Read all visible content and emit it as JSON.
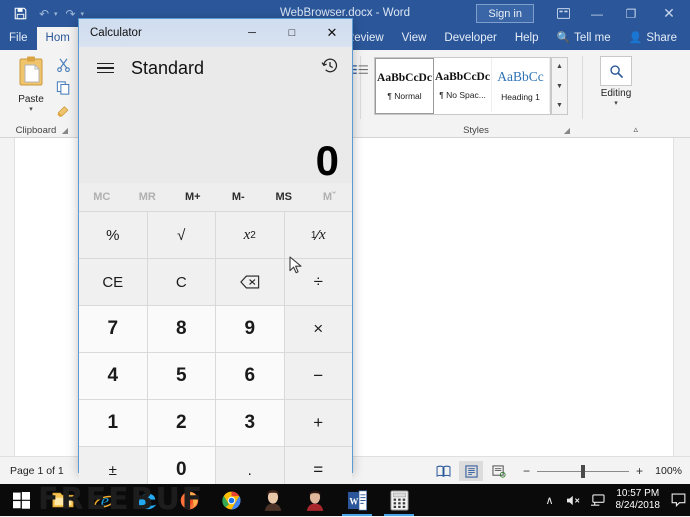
{
  "word": {
    "title": "WebBrowser.docx  -  Word",
    "quick_access": [
      {
        "name": "save-icon",
        "glyph": "💾"
      },
      {
        "name": "undo-icon",
        "glyph": "↶"
      },
      {
        "name": "redo-icon",
        "glyph": "↷"
      },
      {
        "name": "customize-qat-icon",
        "glyph": "⌄"
      }
    ],
    "signin_label": "Sign in",
    "titlebar_buttons": [
      {
        "name": "ribbon-display-options-icon",
        "glyph": "⌧"
      },
      {
        "name": "minimize-icon",
        "glyph": "—"
      },
      {
        "name": "restore-icon",
        "glyph": "❐"
      },
      {
        "name": "close-icon",
        "glyph": "✕"
      }
    ],
    "tabs_left": [
      {
        "label": "File",
        "active": false
      },
      {
        "label": "Hom",
        "active": true
      }
    ],
    "tabs_right": [
      {
        "label": "Review"
      },
      {
        "label": "View"
      },
      {
        "label": "Developer"
      },
      {
        "label": "Help"
      }
    ],
    "tell_me": "Tell me",
    "share": "Share",
    "groups": {
      "clipboard": {
        "label": "Clipboard",
        "paste_label": "Paste",
        "mini_icons": [
          "cut-icon",
          "copy-icon",
          "format-painter-icon"
        ]
      },
      "styles": {
        "label": "Styles",
        "items": [
          {
            "preview": "AaBbCcDc",
            "name": "¶ Normal",
            "selected": true,
            "kind": "body"
          },
          {
            "preview": "AaBbCcDc",
            "name": "¶ No Spac...",
            "selected": false,
            "kind": "body"
          },
          {
            "preview": "AaBbCс",
            "name": "Heading 1",
            "selected": false,
            "kind": "h1"
          }
        ]
      },
      "editing": {
        "label": "Editing",
        "icon": "search-icon",
        "caret": "⌄"
      }
    },
    "ribbon_collapse_icon": "chevron-up-icon",
    "status": {
      "page": "Page 1 of 1",
      "views": [
        {
          "name": "read-mode-view-button",
          "glyph": "📖",
          "active": false
        },
        {
          "name": "print-layout-view-button",
          "glyph": "☰",
          "active": true
        },
        {
          "name": "web-layout-view-button",
          "glyph": "🗏",
          "active": false
        }
      ],
      "zoom_minus": "−",
      "zoom_plus": "+",
      "zoom_value": "100%"
    }
  },
  "calculator": {
    "window_title": "Calculator",
    "window_buttons": [
      {
        "name": "calc-minimize-button",
        "glyph": "─"
      },
      {
        "name": "calc-maximize-button",
        "glyph": "□"
      },
      {
        "name": "calc-close-button",
        "glyph": "✕"
      }
    ],
    "menu_icon": "hamburger-menu-icon",
    "mode": "Standard",
    "history_icon": "history-icon",
    "display_value": "0",
    "memory_buttons": [
      {
        "label": "MC",
        "enabled": false
      },
      {
        "label": "MR",
        "enabled": false
      },
      {
        "label": "M+",
        "enabled": true
      },
      {
        "label": "M-",
        "enabled": true
      },
      {
        "label": "MS",
        "enabled": true
      },
      {
        "label": "Mˇ",
        "enabled": false
      }
    ],
    "keys": [
      {
        "label": "%",
        "type": "fn",
        "name": "percent-key"
      },
      {
        "label": "√",
        "type": "fn",
        "name": "square-root-key"
      },
      {
        "label": "x²",
        "type": "fn",
        "name": "square-key"
      },
      {
        "label": "¹⁄x",
        "type": "fn",
        "name": "reciprocal-key"
      },
      {
        "label": "CE",
        "type": "fn",
        "name": "clear-entry-key"
      },
      {
        "label": "C",
        "type": "fn",
        "name": "clear-key"
      },
      {
        "label": "⌫",
        "type": "fn",
        "name": "backspace-key"
      },
      {
        "label": "÷",
        "type": "op",
        "name": "divide-key"
      },
      {
        "label": "7",
        "type": "num",
        "name": "digit-7-key"
      },
      {
        "label": "8",
        "type": "num",
        "name": "digit-8-key"
      },
      {
        "label": "9",
        "type": "num",
        "name": "digit-9-key"
      },
      {
        "label": "×",
        "type": "op",
        "name": "multiply-key"
      },
      {
        "label": "4",
        "type": "num",
        "name": "digit-4-key"
      },
      {
        "label": "5",
        "type": "num",
        "name": "digit-5-key"
      },
      {
        "label": "6",
        "type": "num",
        "name": "digit-6-key"
      },
      {
        "label": "−",
        "type": "op",
        "name": "subtract-key"
      },
      {
        "label": "1",
        "type": "num",
        "name": "digit-1-key"
      },
      {
        "label": "2",
        "type": "num",
        "name": "digit-2-key"
      },
      {
        "label": "3",
        "type": "num",
        "name": "digit-3-key"
      },
      {
        "label": "+",
        "type": "op",
        "name": "add-key"
      },
      {
        "label": "±",
        "type": "fn",
        "name": "plus-minus-key"
      },
      {
        "label": "0",
        "type": "num",
        "name": "digit-0-key"
      },
      {
        "label": ".",
        "type": "fn",
        "name": "decimal-point-key"
      },
      {
        "label": "=",
        "type": "op",
        "name": "equals-key"
      }
    ]
  },
  "taskbar": {
    "items": [
      {
        "name": "start-button",
        "icon": "windows-logo-icon",
        "running": false
      },
      {
        "name": "taskbar-file-explorer",
        "icon": "folder-icon",
        "running": false
      },
      {
        "name": "taskbar-internet-explorer",
        "icon": "internet-explorer-icon",
        "running": false
      },
      {
        "name": "taskbar-edge",
        "icon": "edge-icon",
        "running": false
      },
      {
        "name": "taskbar-firefox",
        "icon": "firefox-icon",
        "running": false
      },
      {
        "name": "taskbar-chrome",
        "icon": "chrome-icon",
        "running": false
      },
      {
        "name": "taskbar-photos-1",
        "icon": "person-photo-icon",
        "running": false
      },
      {
        "name": "taskbar-photos-2",
        "icon": "person-photo-icon",
        "running": false
      },
      {
        "name": "taskbar-word",
        "icon": "word-icon",
        "running": true
      },
      {
        "name": "taskbar-calculator",
        "icon": "calculator-icon",
        "running": true
      }
    ],
    "tray": [
      {
        "name": "show-hidden-icons-button",
        "glyph": "∧"
      },
      {
        "name": "volume-muted-icon",
        "glyph": "🔇"
      },
      {
        "name": "network-icon",
        "glyph": "🖥"
      }
    ],
    "clock_time": "10:57 PM",
    "clock_date": "8/24/2018",
    "action_center_icon": "action-center-icon",
    "watermark": "FREEBUF"
  },
  "colors": {
    "word_blue": "#2b579a",
    "accent_border": "#5b9bd5",
    "taskbar": "#0a0a0a"
  }
}
